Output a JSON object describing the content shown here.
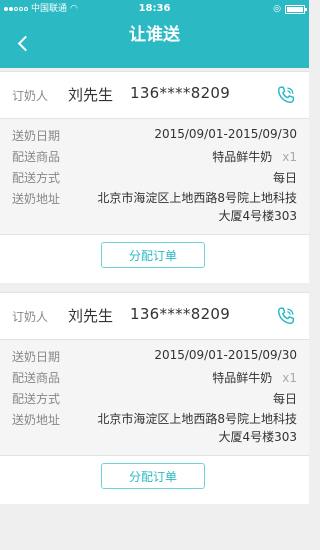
{
  "status_bar": {
    "carrier": "中国联通",
    "time": "18:36"
  },
  "header": {
    "title": "让谁送"
  },
  "orders": [
    {
      "orderer_label": "订奶人",
      "name": "刘先生",
      "phone": "136****8209",
      "details": [
        {
          "label": "送奶日期",
          "value": "2015/09/01-2015/09/30"
        },
        {
          "label": "配送商品",
          "value": "特品鲜牛奶",
          "qty": "x1"
        },
        {
          "label": "配送方式",
          "value": "每日"
        },
        {
          "label": "送奶地址",
          "value": "北京市海淀区上地西路8号院上地科技大厦4号楼303"
        }
      ],
      "action_label": "分配订单"
    },
    {
      "orderer_label": "订奶人",
      "name": "刘先生",
      "phone": "136****8209",
      "details": [
        {
          "label": "送奶日期",
          "value": "2015/09/01-2015/09/30"
        },
        {
          "label": "配送商品",
          "value": "特品鲜牛奶",
          "qty": "x1"
        },
        {
          "label": "配送方式",
          "value": "每日"
        },
        {
          "label": "送奶地址",
          "value": "北京市海淀区上地西路8号院上地科技大厦4号楼303"
        }
      ],
      "action_label": "分配订单"
    }
  ],
  "icons": {
    "back": "chevron-left-icon",
    "call": "phone-icon"
  },
  "colors": {
    "primary": "#2bb9c4",
    "background": "#efefef"
  }
}
